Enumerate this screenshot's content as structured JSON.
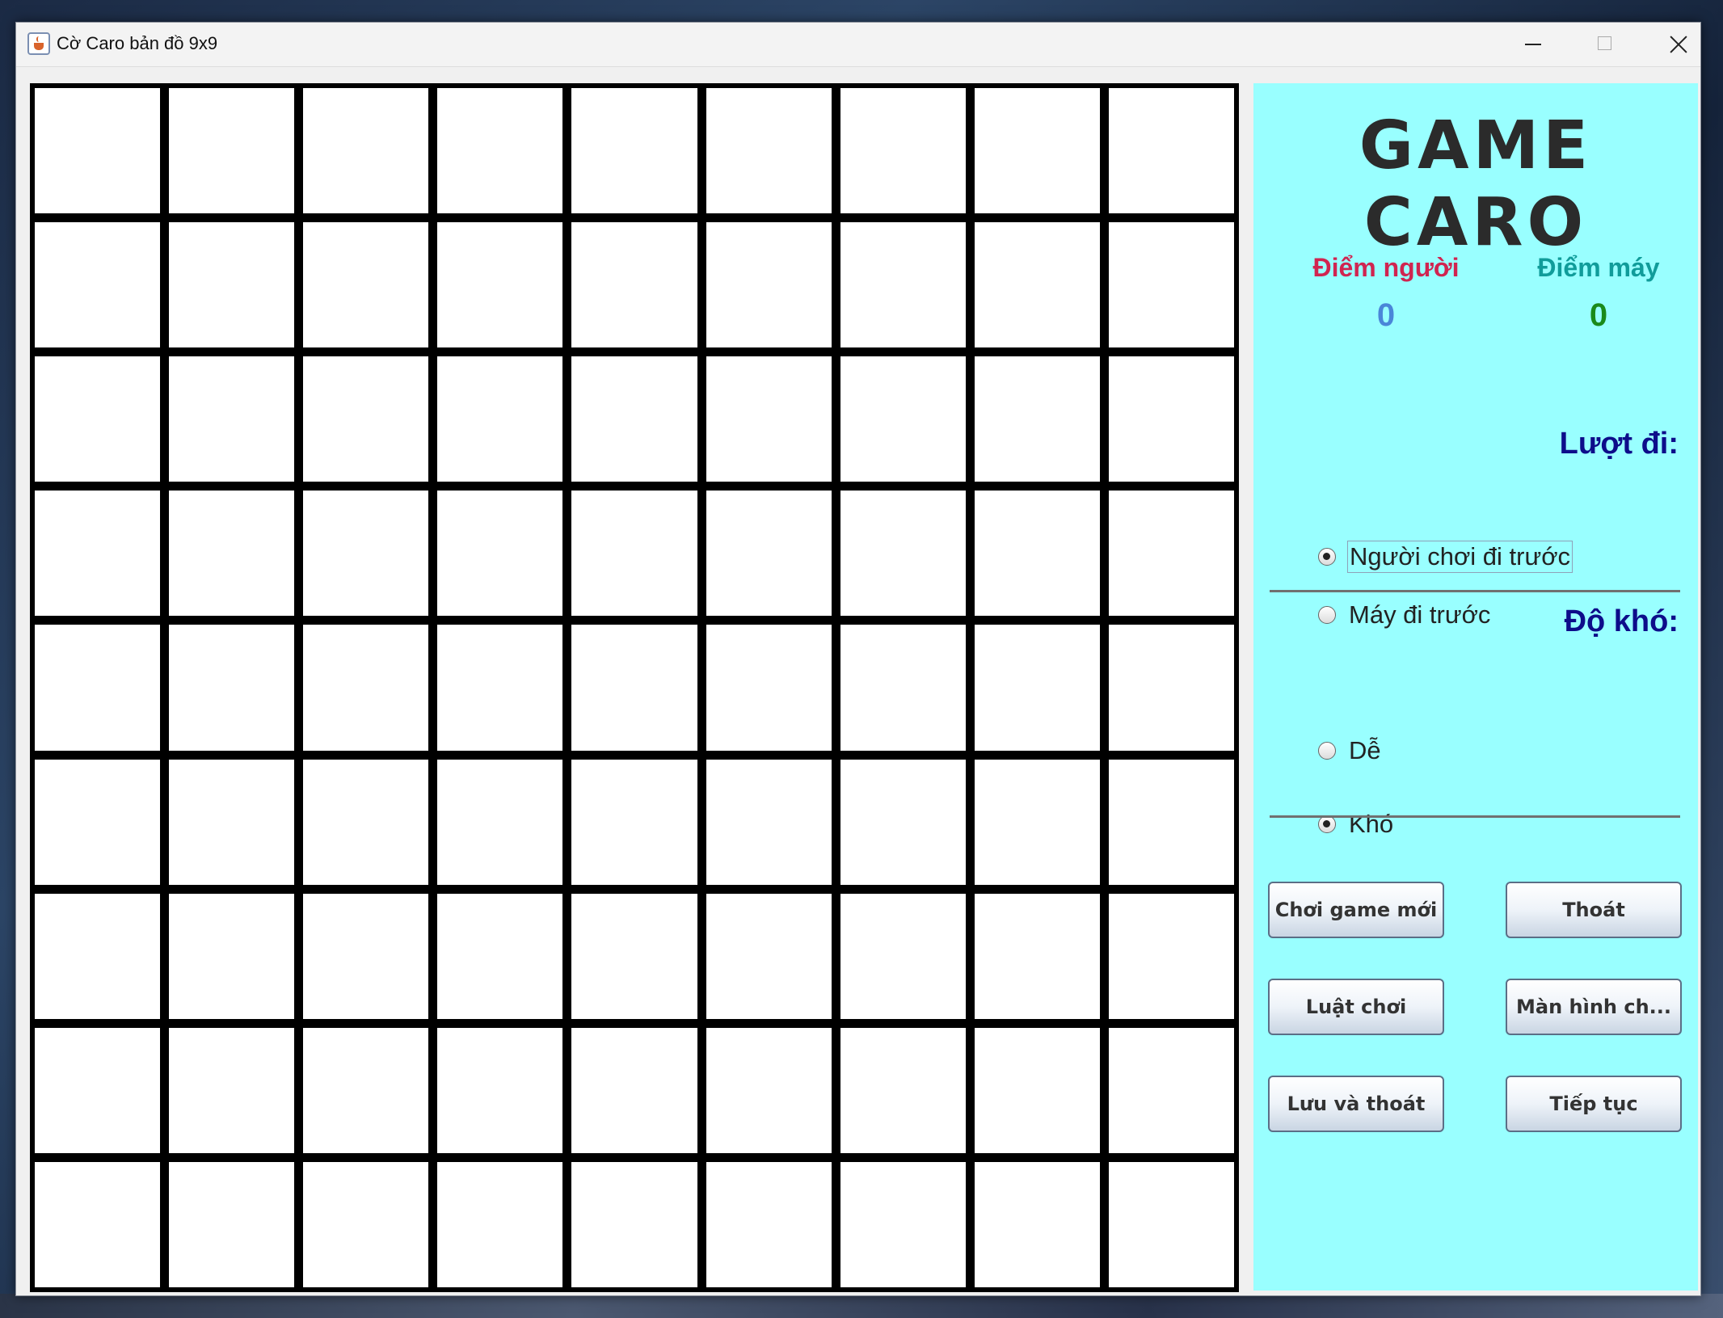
{
  "window": {
    "title": "Cờ Caro bản đồ 9x9",
    "controls": [
      "minimize",
      "maximize",
      "close"
    ]
  },
  "board": {
    "rows": 9,
    "cols": 9,
    "cells": [
      [
        "",
        "",
        "",
        "",
        "",
        "",
        "",
        "",
        ""
      ],
      [
        "",
        "",
        "",
        "",
        "",
        "",
        "",
        "",
        ""
      ],
      [
        "",
        "",
        "",
        "",
        "",
        "",
        "",
        "",
        ""
      ],
      [
        "",
        "",
        "",
        "",
        "",
        "",
        "",
        "",
        ""
      ],
      [
        "",
        "",
        "",
        "",
        "",
        "",
        "",
        "",
        ""
      ],
      [
        "",
        "",
        "",
        "",
        "",
        "",
        "",
        "",
        ""
      ],
      [
        "",
        "",
        "",
        "",
        "",
        "",
        "",
        "",
        ""
      ],
      [
        "",
        "",
        "",
        "",
        "",
        "",
        "",
        "",
        ""
      ],
      [
        "",
        "",
        "",
        "",
        "",
        "",
        "",
        "",
        ""
      ]
    ]
  },
  "panel": {
    "title": "GAME CARO",
    "background": "#99ffff",
    "score": {
      "human_label": "Điểm người",
      "human_value": "0",
      "machine_label": "Điểm máy",
      "machine_value": "0"
    },
    "turn": {
      "title": "Lượt đi:",
      "options": [
        {
          "label": "Người chơi đi trước",
          "selected": true
        },
        {
          "label": "Máy đi trước",
          "selected": false
        }
      ]
    },
    "difficulty": {
      "title": "Độ khó:",
      "options": [
        {
          "label": "Dễ",
          "selected": false
        },
        {
          "label": "Khó",
          "selected": true
        }
      ]
    },
    "buttons": {
      "new_game": "Chơi game mới",
      "exit": "Thoát",
      "rules": "Luật chơi",
      "main_screen": "Màn hình ch...",
      "save_exit": "Lưu và thoát",
      "continue": "Tiếp tục"
    }
  },
  "colors": {
    "human_label": "#d02450",
    "machine_label": "#109c9a",
    "human_score": "#4a86d8",
    "machine_score": "#1a8a1a",
    "section_title": "#0d0d8a"
  }
}
